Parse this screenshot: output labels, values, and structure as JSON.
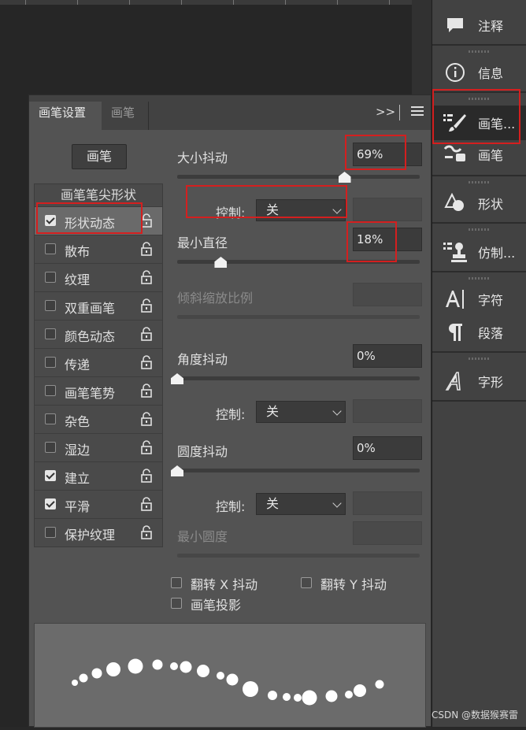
{
  "panel": {
    "tabs": [
      {
        "label": "画笔设置",
        "active": true
      },
      {
        "label": "画笔",
        "active": false
      }
    ],
    "expand_glyph": ">>",
    "brush_button": "画笔",
    "tip_shape_header": "画笔笔尖形状",
    "options": [
      {
        "label": "形状动态",
        "checked": true,
        "selected": true
      },
      {
        "label": "散布",
        "checked": false
      },
      {
        "label": "纹理",
        "checked": false
      },
      {
        "label": "双重画笔",
        "checked": false
      },
      {
        "label": "颜色动态",
        "checked": false
      },
      {
        "label": "传递",
        "checked": false
      },
      {
        "label": "画笔笔势",
        "checked": false
      },
      {
        "label": "杂色",
        "checked": false
      },
      {
        "label": "湿边",
        "checked": false
      },
      {
        "label": "建立",
        "checked": true
      },
      {
        "label": "平滑",
        "checked": true
      },
      {
        "label": "保护纹理",
        "checked": false
      }
    ],
    "size_jitter": {
      "label": "大小抖动",
      "value": "69%",
      "level": 0.69
    },
    "control1": {
      "label": "控制:",
      "value": "关"
    },
    "min_diameter": {
      "label": "最小直径",
      "value": "18%",
      "level": 0.18
    },
    "tilt_scale": {
      "label": "倾斜缩放比例"
    },
    "angle_jitter": {
      "label": "角度抖动",
      "value": "0%",
      "level": 0
    },
    "control2": {
      "label": "控制:",
      "value": "关"
    },
    "roundness_jitter": {
      "label": "圆度抖动",
      "value": "0%",
      "level": 0
    },
    "control3": {
      "label": "控制:",
      "value": "关"
    },
    "min_roundness": {
      "label": "最小圆度"
    },
    "flip_x": {
      "label": "翻转 X 抖动",
      "checked": false
    },
    "flip_y": {
      "label": "翻转 Y 抖动",
      "checked": false
    },
    "brush_projection": {
      "label": "画笔投影",
      "checked": false
    }
  },
  "dock": {
    "items": [
      {
        "label": "注释",
        "icon": "comment-icon"
      },
      {
        "label": "信息",
        "icon": "info-icon"
      },
      {
        "label": "画笔...",
        "icon": "brush-settings-icon",
        "active": true
      },
      {
        "label": "画笔",
        "icon": "brush-presets-icon"
      },
      {
        "label": "形状",
        "icon": "shapes-icon"
      },
      {
        "label": "仿制...",
        "icon": "clone-source-icon"
      },
      {
        "label": "字符",
        "icon": "character-icon"
      },
      {
        "label": "段落",
        "icon": "paragraph-icon"
      },
      {
        "label": "字形",
        "icon": "glyphs-icon"
      }
    ]
  },
  "watermark": "CSDN @数据猴赛雷",
  "colors": {
    "panel": "#535353",
    "dock": "#424242",
    "highlight": "#d41f1f"
  }
}
